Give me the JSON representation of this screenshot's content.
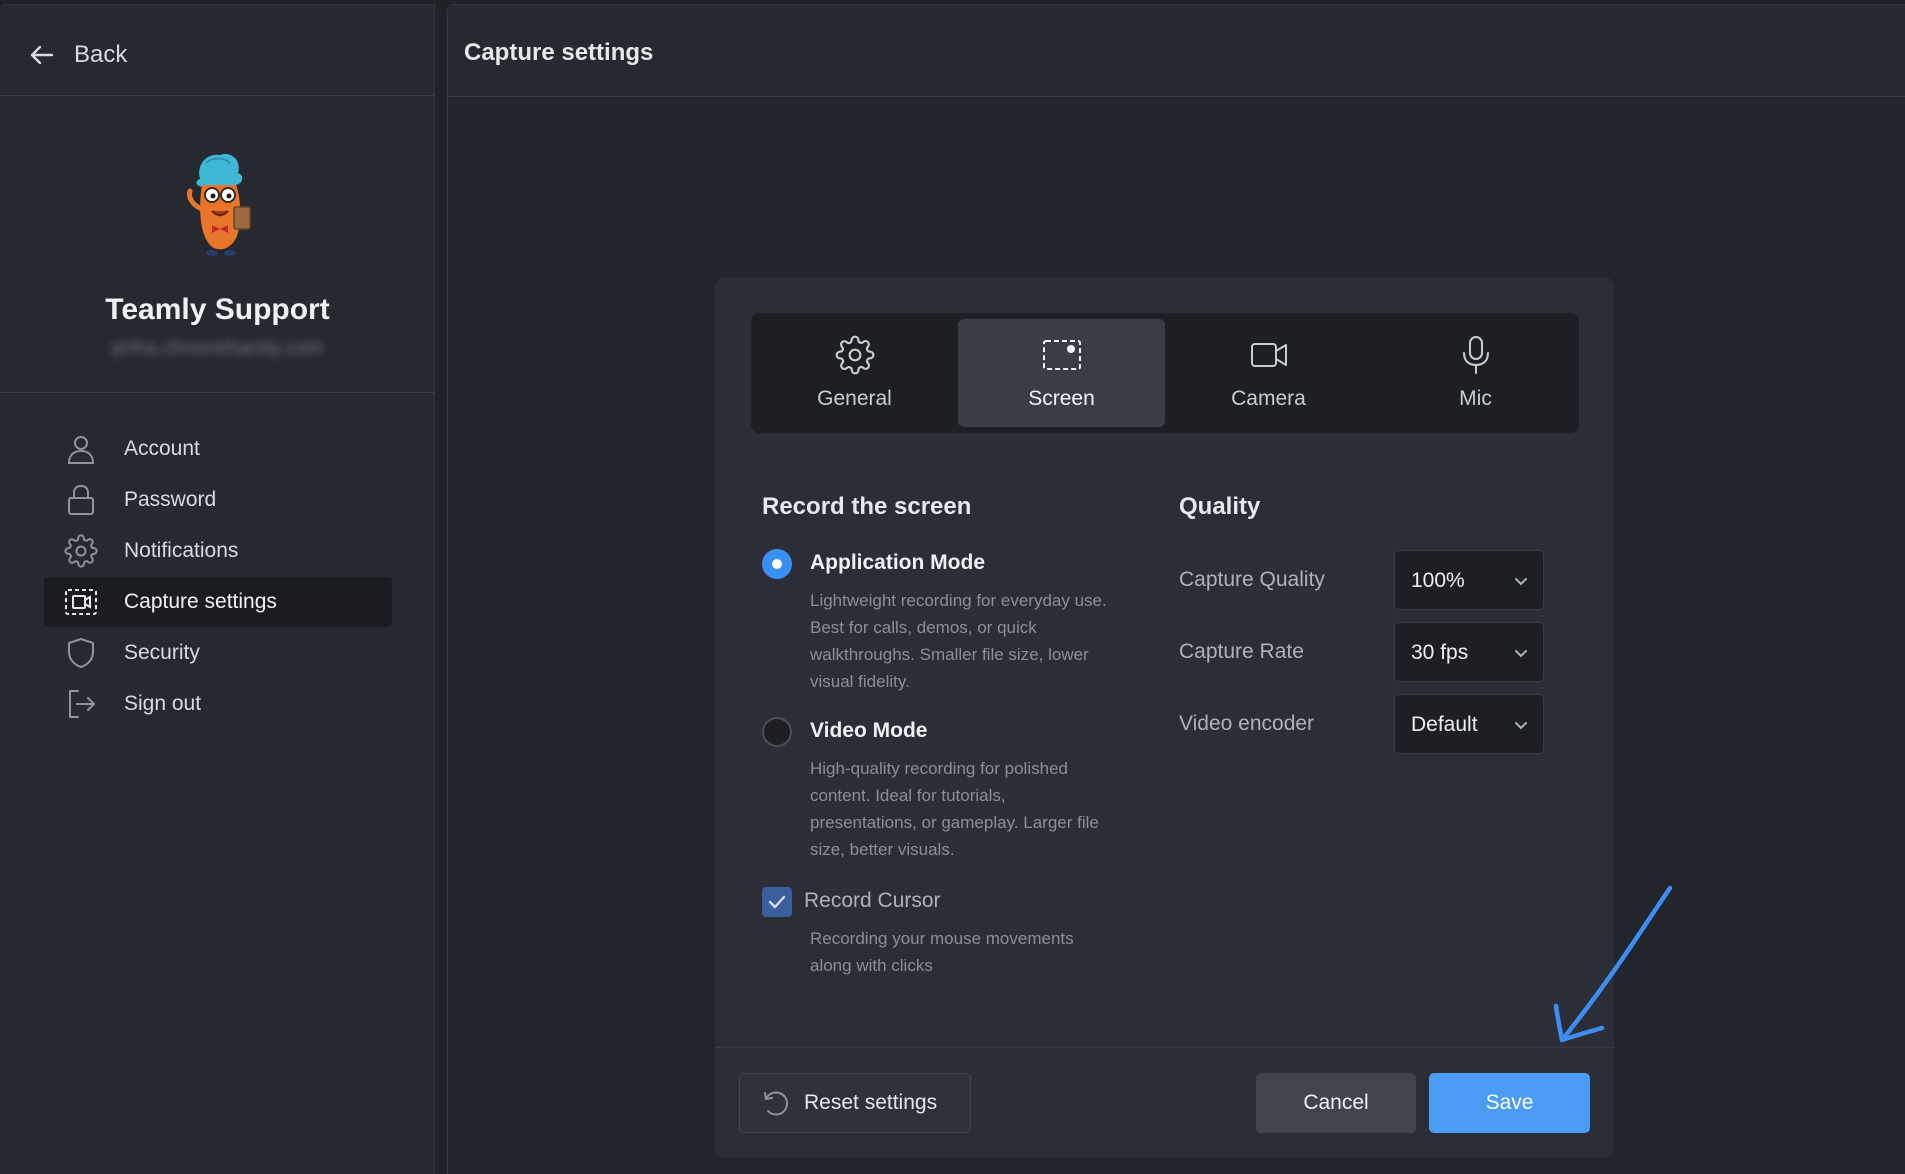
{
  "sidebar": {
    "back_label": "Back",
    "profile": {
      "name": "Teamly Support",
      "email": "priha.chnorwhandy.com"
    },
    "items": [
      {
        "label": "Account",
        "icon": "user-icon",
        "active": false
      },
      {
        "label": "Password",
        "icon": "lock-icon",
        "active": false
      },
      {
        "label": "Notifications",
        "icon": "gear-icon",
        "active": false
      },
      {
        "label": "Capture settings",
        "icon": "screen-capture-icon",
        "active": true
      },
      {
        "label": "Security",
        "icon": "shield-icon",
        "active": false
      },
      {
        "label": "Sign out",
        "icon": "sign-out-icon",
        "active": false
      }
    ]
  },
  "header": {
    "title": "Capture settings"
  },
  "dialog": {
    "tabs": [
      {
        "label": "General",
        "icon": "gear-icon",
        "active": false
      },
      {
        "label": "Screen",
        "icon": "screen-capture-icon",
        "active": true
      },
      {
        "label": "Camera",
        "icon": "camera-icon",
        "active": false
      },
      {
        "label": "Mic",
        "icon": "microphone-icon",
        "active": false
      }
    ],
    "record": {
      "title": "Record the screen",
      "options": [
        {
          "label": "Application Mode",
          "selected": true,
          "desc_lines": [
            "Lightweight recording for everyday use.",
            "Best for calls, demos, or quick",
            "walkthroughs. Smaller file size, lower",
            "visual fidelity."
          ]
        },
        {
          "label": "Video Mode",
          "selected": false,
          "desc_lines": [
            "High-quality recording for polished",
            "content. Ideal for tutorials,",
            "presentations, or gameplay. Larger file",
            "size, better visuals."
          ]
        }
      ],
      "cursor": {
        "label": "Record Cursor",
        "checked": true,
        "desc_lines": [
          "Recording your mouse movements",
          "along with clicks"
        ]
      }
    },
    "quality": {
      "title": "Quality",
      "rows": [
        {
          "label": "Capture Quality",
          "value": "100%"
        },
        {
          "label": "Capture Rate",
          "value": "30 fps"
        },
        {
          "label": "Video encoder",
          "value": "Default"
        }
      ]
    },
    "footer": {
      "reset_label": "Reset settings",
      "cancel_label": "Cancel",
      "save_label": "Save"
    }
  },
  "colors": {
    "accent": "#4a9cf5",
    "radio_selected": "#3b8ff3",
    "checkbox": "#3a5f9c",
    "annotation_arrow": "#3d8ef0",
    "background": "#1f2126",
    "panel": "#2b2e36"
  }
}
